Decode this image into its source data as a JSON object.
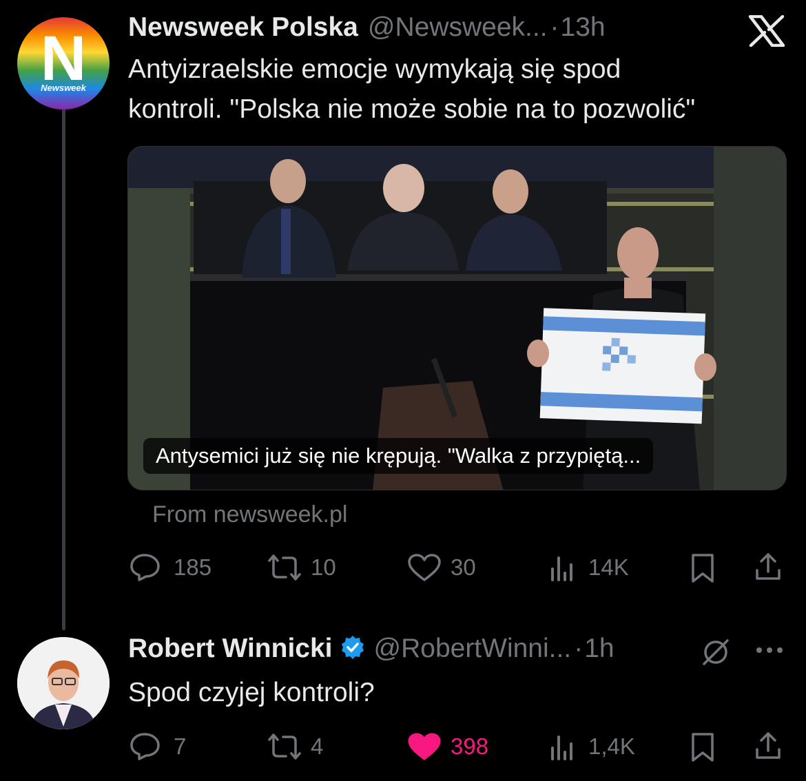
{
  "tweet1": {
    "name": "Newsweek Polska",
    "handle": "@Newsweek...",
    "separator": "·",
    "time": "13h",
    "text_line1": "Antyizraelskie emocje wymykają się spod",
    "text_line2": "kontroli. \"Polska nie może sobie na to pozwolić\"",
    "avatar_letter": "N",
    "avatar_label": "Newsweek",
    "card_caption": "Antysemici już się nie krępują. \"Walka z przypiętą...",
    "card_source": "From newsweek.pl",
    "stats": {
      "replies": "185",
      "reposts": "10",
      "likes": "30",
      "views": "14K"
    }
  },
  "tweet2": {
    "name": "Robert Winnicki",
    "handle": "@RobertWinni...",
    "separator": "·",
    "time": "1h",
    "text": "Spod czyjej kontroli?",
    "stats": {
      "replies": "7",
      "reposts": "4",
      "likes": "398",
      "views": "1,4K"
    }
  },
  "colors": {
    "background": "#000000",
    "text": "#e7e9ea",
    "muted": "#71767b",
    "like": "#f91880",
    "verified": "#1d9bf0"
  }
}
